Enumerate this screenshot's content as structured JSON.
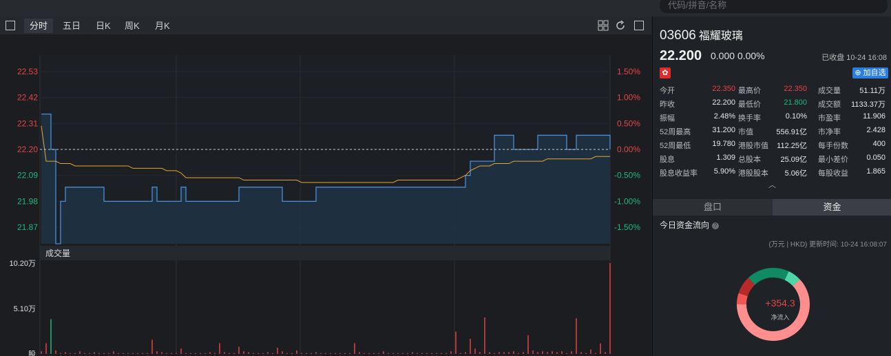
{
  "search": {
    "placeholder": "代码/拼音/名称"
  },
  "chart_tabs": [
    "分时",
    "五日",
    "日K",
    "周K",
    "月K"
  ],
  "active_tab": "分时",
  "price_axis": [
    "22.53",
    "22.42",
    "22.31",
    "22.20",
    "22.09",
    "21.98",
    "21.87"
  ],
  "pct_axis": [
    "1.50%",
    "1.00%",
    "0.50%",
    "0.00%",
    "-0.50%",
    "-1.00%",
    "-1.50%"
  ],
  "volume_section": {
    "title": "成交量",
    "ticks": [
      "10.20万",
      "5.10万",
      "股"
    ]
  },
  "stock": {
    "code": "03606",
    "name": "福耀玻璃",
    "price": "22.200",
    "change": "0.000",
    "change_pct": "0.00%",
    "status": "已收盘 10-24 16:08",
    "market_flag": "✿",
    "add_watch": "加自选"
  },
  "stats": [
    [
      [
        "今开",
        "22.350",
        "red"
      ],
      [
        "最高价",
        "22.350",
        "red"
      ],
      [
        "成交量",
        "51.11万",
        ""
      ]
    ],
    [
      [
        "昨收",
        "22.200",
        ""
      ],
      [
        "最低价",
        "21.800",
        "green"
      ],
      [
        "成交额",
        "1133.37万",
        ""
      ]
    ],
    [
      [
        "振幅",
        "2.48%",
        ""
      ],
      [
        "换手率",
        "0.10%",
        ""
      ],
      [
        "市盈率",
        "11.906",
        ""
      ]
    ],
    [
      [
        "52周最高",
        "31.200",
        ""
      ],
      [
        "市值",
        "556.91亿",
        ""
      ],
      [
        "市净率",
        "2.428",
        ""
      ]
    ],
    [
      [
        "52周最低",
        "19.780",
        ""
      ],
      [
        "港股市值",
        "112.25亿",
        ""
      ],
      [
        "每手份数",
        "400",
        ""
      ]
    ],
    [
      [
        "股息",
        "1.309",
        ""
      ],
      [
        "总股本",
        "25.09亿",
        ""
      ],
      [
        "最小差价",
        "0.050",
        ""
      ]
    ],
    [
      [
        "股息收益率",
        "5.90%",
        ""
      ],
      [
        "港股股本",
        "5.06亿",
        ""
      ],
      [
        "每股收益",
        "1.865",
        ""
      ]
    ]
  ],
  "right_tabs": [
    "盘口",
    "资金"
  ],
  "active_right_tab": "资金",
  "fund_flow": {
    "title": "今日资金流向",
    "unit_note": "(万元 | HKD) 更新时间: 10-24 16:08:07",
    "net_value": "+354.3",
    "net_label": "净流入",
    "donut_shares": [
      0.07,
      0.06,
      0.62,
      0.05,
      0.08,
      0.12
    ],
    "donut_colors": [
      "#0f8a63",
      "#4fd6a8",
      "#ff8f8f",
      "#f25555",
      "#b62a2a",
      "#0f8a63"
    ]
  },
  "chart_data": {
    "type": "line",
    "title": "",
    "ylim": [
      21.8,
      22.6
    ],
    "baseline": 22.2,
    "price": [
      22.35,
      22.35,
      22.2,
      21.8,
      21.98,
      22.04,
      22.04,
      22.04,
      22.04,
      22.04,
      22.04,
      22.04,
      22.04,
      21.98,
      21.98,
      21.98,
      21.98,
      21.98,
      21.98,
      21.98,
      21.98,
      21.98,
      21.98,
      22.04,
      21.98,
      21.98,
      21.98,
      21.98,
      21.98,
      22.04,
      21.98,
      21.98,
      21.98,
      21.98,
      21.98,
      21.98,
      21.98,
      21.98,
      21.98,
      21.98,
      21.98,
      22.04,
      22.04,
      22.04,
      22.04,
      22.04,
      22.04,
      22.04,
      22.04,
      22.04,
      21.98,
      21.98,
      21.98,
      21.98,
      21.98,
      21.98,
      21.98,
      22.04,
      22.04,
      22.04,
      22.04,
      22.04,
      22.04,
      22.04,
      22.04,
      22.04,
      22.04,
      22.04,
      22.04,
      22.04,
      22.04,
      22.04,
      22.04,
      22.04,
      22.04,
      22.04,
      22.04,
      22.04,
      22.04,
      22.04,
      22.04,
      22.04,
      22.04,
      22.04,
      22.04,
      22.04,
      22.04,
      22.04,
      22.09,
      22.15,
      22.15,
      22.15,
      22.15,
      22.15,
      22.26,
      22.26,
      22.26,
      22.26,
      22.2,
      22.2,
      22.2,
      22.2,
      22.2,
      22.26,
      22.26,
      22.26,
      22.26,
      22.26,
      22.26,
      22.2,
      22.2,
      22.26,
      22.26,
      22.26,
      22.26,
      22.26,
      22.26,
      22.26,
      22.2
    ],
    "avg": [
      22.3,
      22.15,
      22.15,
      22.15,
      22.14,
      22.14,
      22.14,
      22.13,
      22.13,
      22.13,
      22.13,
      22.13,
      22.13,
      22.13,
      22.13,
      22.13,
      22.13,
      22.13,
      22.13,
      22.12,
      22.12,
      22.12,
      22.12,
      22.12,
      22.12,
      22.12,
      22.11,
      22.11,
      22.11,
      22.1,
      22.08,
      22.08,
      22.08,
      22.08,
      22.08,
      22.08,
      22.08,
      22.08,
      22.08,
      22.08,
      22.08,
      22.08,
      22.07,
      22.07,
      22.07,
      22.07,
      22.07,
      22.07,
      22.07,
      22.07,
      22.07,
      22.07,
      22.07,
      22.07,
      22.06,
      22.06,
      22.06,
      22.06,
      22.06,
      22.06,
      22.06,
      22.06,
      22.06,
      22.06,
      22.06,
      22.06,
      22.06,
      22.06,
      22.06,
      22.06,
      22.06,
      22.06,
      22.06,
      22.06,
      22.07,
      22.07,
      22.07,
      22.07,
      22.07,
      22.07,
      22.07,
      22.07,
      22.07,
      22.07,
      22.07,
      22.07,
      22.07,
      22.08,
      22.09,
      22.11,
      22.12,
      22.13,
      22.13,
      22.13,
      22.14,
      22.14,
      22.14,
      22.14,
      22.15,
      22.15,
      22.15,
      22.15,
      22.15,
      22.15,
      22.15,
      22.16,
      22.16,
      22.16,
      22.16,
      22.16,
      22.16,
      22.16,
      22.16,
      22.16,
      22.16,
      22.17,
      22.17,
      22.17,
      22.17
    ],
    "volume_max": 10.2,
    "volume": [
      0.3,
      1.2,
      3.9,
      0.4,
      0.1,
      0.2,
      0.1,
      0.1,
      0.3,
      0.1,
      0.1,
      0.2,
      0.1,
      0.1,
      0.1,
      0.3,
      0.1,
      0.1,
      0.1,
      0.1,
      0.1,
      0.1,
      0.1,
      1.6,
      0.3,
      0.2,
      0.1,
      0.1,
      0.1,
      0.6,
      0.1,
      0.1,
      0.1,
      0.1,
      0.1,
      0.2,
      0.1,
      1.2,
      0.2,
      0.1,
      0.1,
      0.8,
      0.3,
      0.2,
      0.1,
      0.1,
      0.1,
      0.2,
      0.1,
      0.7,
      0.3,
      0.1,
      0.1,
      0.4,
      0.1,
      0.1,
      0.1,
      0.2,
      0.1,
      0.1,
      0.1,
      0.1,
      0.1,
      0.1,
      0.1,
      1.2,
      0.2,
      0.1,
      0.1,
      0.1,
      0.1,
      0.3,
      0.1,
      0.1,
      0.1,
      0.1,
      0.1,
      0.2,
      0.1,
      0.1,
      0.1,
      0.1,
      0.1,
      0.1,
      0.1,
      0.3,
      2.5,
      0.1,
      0.2,
      1.7,
      0.6,
      0.2,
      4.1,
      0.2,
      0.1,
      0.2,
      0.2,
      0.2,
      0.3,
      0.1,
      0.2,
      2.1,
      0.4,
      0.2,
      0.3,
      0.2,
      0.3,
      0.2,
      0.3,
      0.1,
      0.3,
      4.0,
      0.2,
      0.1,
      0.5,
      0.1,
      1.2,
      0.2,
      10.2
    ],
    "volume_colors": "mostly red"
  }
}
